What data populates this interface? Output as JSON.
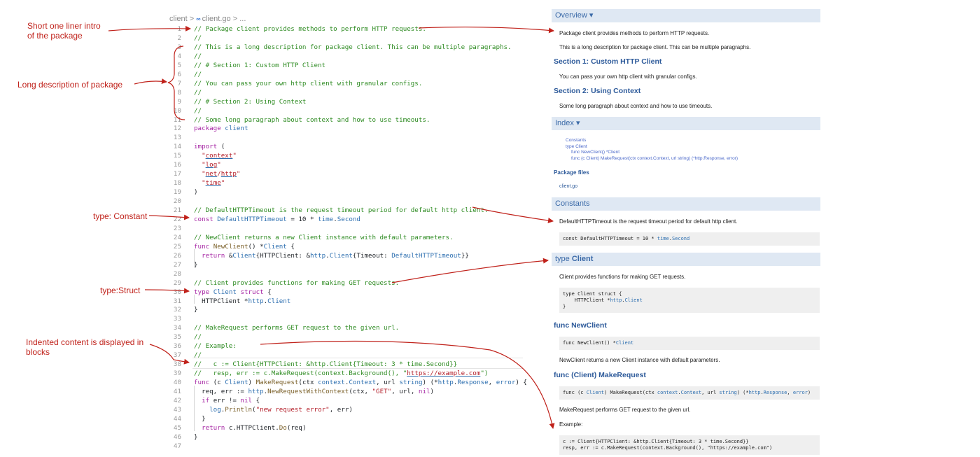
{
  "annotations": {
    "intro": "Short one liner intro\nof the package",
    "long_desc": "Long description of package",
    "constant": "type: Constant",
    "struct": "type:Struct",
    "indented": "Indented content is displayed in\nblocks"
  },
  "editor": {
    "breadcrumb_root": "client",
    "breadcrumb_sep": ">",
    "breadcrumb_icon": "∞",
    "breadcrumb_file": "client.go",
    "breadcrumb_more": "...",
    "lines": [
      {
        "n": "1",
        "segs": [
          [
            "c",
            "// Package client provides methods to perform HTTP requests."
          ]
        ]
      },
      {
        "n": "2",
        "segs": [
          [
            "c",
            "//"
          ]
        ]
      },
      {
        "n": "3",
        "segs": [
          [
            "c",
            "// This is a long description for package client. This can be multiple paragraphs."
          ]
        ]
      },
      {
        "n": "4",
        "segs": [
          [
            "c",
            "//"
          ]
        ]
      },
      {
        "n": "5",
        "segs": [
          [
            "c",
            "// # Section 1: Custom HTTP Client"
          ]
        ]
      },
      {
        "n": "6",
        "segs": [
          [
            "c",
            "//"
          ]
        ]
      },
      {
        "n": "7",
        "segs": [
          [
            "c",
            "// You can pass your own http client with granular configs."
          ]
        ]
      },
      {
        "n": "8",
        "segs": [
          [
            "c",
            "//"
          ]
        ]
      },
      {
        "n": "9",
        "segs": [
          [
            "c",
            "// # Section 2: Using Context"
          ]
        ]
      },
      {
        "n": "10",
        "segs": [
          [
            "c",
            "//"
          ]
        ]
      },
      {
        "n": "11",
        "segs": [
          [
            "c",
            "// Some long paragraph about context and how to use timeouts."
          ]
        ]
      },
      {
        "n": "12",
        "segs": [
          [
            "k",
            "package"
          ],
          [
            "p",
            " "
          ],
          [
            "t",
            "client"
          ]
        ]
      },
      {
        "n": "13",
        "segs": []
      },
      {
        "n": "14",
        "segs": [
          [
            "k",
            "import"
          ],
          [
            "p",
            " ("
          ]
        ]
      },
      {
        "n": "15",
        "segs": [
          [
            "p",
            "  "
          ],
          [
            "s",
            "\""
          ],
          [
            "u",
            "context"
          ],
          [
            "s",
            "\""
          ]
        ]
      },
      {
        "n": "16",
        "segs": [
          [
            "p",
            "  "
          ],
          [
            "s",
            "\""
          ],
          [
            "u",
            "log"
          ],
          [
            "s",
            "\""
          ]
        ]
      },
      {
        "n": "17",
        "segs": [
          [
            "p",
            "  "
          ],
          [
            "s",
            "\""
          ],
          [
            "u",
            "net"
          ],
          [
            "s",
            "/"
          ],
          [
            "u",
            "http"
          ],
          [
            "s",
            "\""
          ]
        ]
      },
      {
        "n": "18",
        "segs": [
          [
            "p",
            "  "
          ],
          [
            "s",
            "\""
          ],
          [
            "u",
            "time"
          ],
          [
            "s",
            "\""
          ]
        ]
      },
      {
        "n": "19",
        "segs": [
          [
            "p",
            ")"
          ]
        ]
      },
      {
        "n": "20",
        "segs": []
      },
      {
        "n": "21",
        "segs": [
          [
            "c",
            "// DefaultHTTPTimeout is the request timeout period for default http client."
          ]
        ]
      },
      {
        "n": "22",
        "segs": [
          [
            "k",
            "const"
          ],
          [
            "p",
            " "
          ],
          [
            "t",
            "DefaultHTTPTimeout"
          ],
          [
            "p",
            " = 10 * "
          ],
          [
            "t",
            "time"
          ],
          [
            "p",
            "."
          ],
          [
            "t",
            "Second"
          ]
        ]
      },
      {
        "n": "23",
        "segs": []
      },
      {
        "n": "24",
        "segs": [
          [
            "c",
            "// NewClient returns a new Client instance with default parameters."
          ]
        ]
      },
      {
        "n": "25",
        "segs": [
          [
            "k",
            "func"
          ],
          [
            "p",
            " "
          ],
          [
            "f",
            "NewClient"
          ],
          [
            "p",
            "() *"
          ],
          [
            "t",
            "Client"
          ],
          [
            "p",
            " {"
          ]
        ]
      },
      {
        "n": "26",
        "segs": [
          [
            "p",
            "  "
          ],
          [
            "k",
            "return"
          ],
          [
            "p",
            " &"
          ],
          [
            "t",
            "Client"
          ],
          [
            "p",
            "{HTTPClient: &"
          ],
          [
            "t",
            "http"
          ],
          [
            "p",
            "."
          ],
          [
            "t",
            "Client"
          ],
          [
            "p",
            "{Timeout: "
          ],
          [
            "t",
            "DefaultHTTPTimeout"
          ],
          [
            "p",
            "}}"
          ]
        ]
      },
      {
        "n": "27",
        "segs": [
          [
            "p",
            "}"
          ]
        ]
      },
      {
        "n": "28",
        "segs": []
      },
      {
        "n": "29",
        "segs": [
          [
            "c",
            "// Client provides functions for making GET requests."
          ]
        ]
      },
      {
        "n": "30",
        "segs": [
          [
            "k",
            "type"
          ],
          [
            "p",
            " "
          ],
          [
            "t",
            "Client"
          ],
          [
            "p",
            " "
          ],
          [
            "k",
            "struct"
          ],
          [
            "p",
            " {"
          ]
        ]
      },
      {
        "n": "31",
        "segs": [
          [
            "p",
            "  HTTPClient *"
          ],
          [
            "t",
            "http"
          ],
          [
            "p",
            "."
          ],
          [
            "t",
            "Client"
          ]
        ]
      },
      {
        "n": "32",
        "segs": [
          [
            "p",
            "}"
          ]
        ]
      },
      {
        "n": "33",
        "segs": []
      },
      {
        "n": "34",
        "segs": [
          [
            "c",
            "// MakeRequest performs GET request to the given url."
          ]
        ]
      },
      {
        "n": "35",
        "segs": [
          [
            "c",
            "//"
          ]
        ]
      },
      {
        "n": "36",
        "segs": [
          [
            "c",
            "// Example:"
          ]
        ]
      },
      {
        "n": "37",
        "segs": [
          [
            "c",
            "//"
          ]
        ]
      },
      {
        "n": "38",
        "segs": [
          [
            "c",
            "//   c := Client{HTTPClient: &http.Client{Timeout: 3 * time.Second}}"
          ]
        ]
      },
      {
        "n": "39",
        "segs": [
          [
            "c",
            "//   resp, err := c.MakeRequest(context.Background(), \""
          ],
          [
            "u",
            "https://example.com"
          ],
          [
            "c",
            "\")"
          ]
        ]
      },
      {
        "n": "40",
        "segs": [
          [
            "k",
            "func"
          ],
          [
            "p",
            " (c "
          ],
          [
            "t",
            "Client"
          ],
          [
            "p",
            ") "
          ],
          [
            "f",
            "MakeRequest"
          ],
          [
            "p",
            "(ctx "
          ],
          [
            "t",
            "context"
          ],
          [
            "p",
            "."
          ],
          [
            "t",
            "Context"
          ],
          [
            "p",
            ", url "
          ],
          [
            "t",
            "string"
          ],
          [
            "p",
            ") (*"
          ],
          [
            "t",
            "http"
          ],
          [
            "p",
            "."
          ],
          [
            "t",
            "Response"
          ],
          [
            "p",
            ", "
          ],
          [
            "t",
            "error"
          ],
          [
            "p",
            ") {"
          ]
        ]
      },
      {
        "n": "41",
        "segs": [
          [
            "p",
            "  req, err := "
          ],
          [
            "t",
            "http"
          ],
          [
            "p",
            "."
          ],
          [
            "f",
            "NewRequestWithContext"
          ],
          [
            "p",
            "(ctx, "
          ],
          [
            "s",
            "\"GET\""
          ],
          [
            "p",
            ", url, "
          ],
          [
            "k",
            "nil"
          ],
          [
            "p",
            ")"
          ]
        ]
      },
      {
        "n": "42",
        "segs": [
          [
            "p",
            "  "
          ],
          [
            "k",
            "if"
          ],
          [
            "p",
            " err != "
          ],
          [
            "k",
            "nil"
          ],
          [
            "p",
            " {"
          ]
        ]
      },
      {
        "n": "43",
        "segs": [
          [
            "p",
            "    "
          ],
          [
            "t",
            "log"
          ],
          [
            "p",
            "."
          ],
          [
            "f",
            "Println"
          ],
          [
            "p",
            "("
          ],
          [
            "s",
            "\"new request error\""
          ],
          [
            "p",
            ", err)"
          ]
        ]
      },
      {
        "n": "44",
        "segs": [
          [
            "p",
            "  }"
          ]
        ]
      },
      {
        "n": "45",
        "segs": [
          [
            "p",
            "  "
          ],
          [
            "k",
            "return"
          ],
          [
            "p",
            " c.HTTPClient."
          ],
          [
            "f",
            "Do"
          ],
          [
            "p",
            "(req)"
          ]
        ]
      },
      {
        "n": "46",
        "segs": [
          [
            "p",
            "}"
          ]
        ]
      },
      {
        "n": "47",
        "segs": []
      }
    ]
  },
  "docs": {
    "overview": "Overview ▾",
    "intro": "Package client provides methods to perform HTTP requests.",
    "long": "This is a long description for package client. This can be multiple paragraphs.",
    "sec1_title": "Section 1: Custom HTTP Client",
    "sec1_text": "You can pass your own http client with granular configs.",
    "sec2_title": "Section 2: Using Context",
    "sec2_text": "Some long paragraph about context and how to use timeouts.",
    "index": "Index ▾",
    "idx_constants": "Constants",
    "idx_type_client": "type Client",
    "idx_newclient": "func NewClient() *Client",
    "idx_makerequest": "func (c Client) MakeRequest(ctx context.Context, url string) (*http.Response, error)",
    "pkg_files": "Package files",
    "file": "client.go",
    "constants": "Constants",
    "const_text": "DefaultHTTPTimeout is the request timeout period for default http client.",
    "const_code_a": "const DefaultHTTPTimeout = 10 * ",
    "const_code_b": "time",
    "const_code_c": ".",
    "const_code_d": "Second",
    "type_client_a": "type ",
    "type_client_b": "Client",
    "client_text": "Client provides functions for making GET requests.",
    "client_code_1": "type Client struct {",
    "client_code_2a": "    HTTPClient *",
    "client_code_2b": "http",
    "client_code_2c": ".",
    "client_code_2d": "Client",
    "client_code_3": "}",
    "newclient_title": "func NewClient",
    "newclient_code_a": "func NewClient() *",
    "newclient_code_b": "Client",
    "newclient_text": "NewClient returns a new Client instance with default parameters.",
    "makereq_title": "func (Client) MakeRequest",
    "makereq_code_1": "func (c ",
    "makereq_code_2": "Client",
    "makereq_code_3": ") MakeRequest(ctx ",
    "makereq_code_4": "context",
    "makereq_code_5": ".",
    "makereq_code_6": "Context",
    "makereq_code_7": ", url ",
    "makereq_code_8": "string",
    "makereq_code_9": ") (*",
    "makereq_code_10": "http",
    "makereq_code_11": ".",
    "makereq_code_12": "Response",
    "makereq_code_13": ", ",
    "makereq_code_14": "error",
    "makereq_code_15": ")",
    "makereq_text": "MakeRequest performs GET request to the given url.",
    "example_label": "Example:",
    "example_1": "c := Client{HTTPClient: &http.Client{Timeout: 3 * time.Second}}",
    "example_2": "resp, err := c.MakeRequest(context.Background(), \"https://example.com\")"
  },
  "colors": {
    "annotation": "#c0221b",
    "band": "#dfe8f3",
    "doc_link": "#2d5a9a",
    "comment": "#2e8b22",
    "keyword": "#a626a4",
    "type": "#2d6fb0",
    "string": "#b31d28"
  }
}
